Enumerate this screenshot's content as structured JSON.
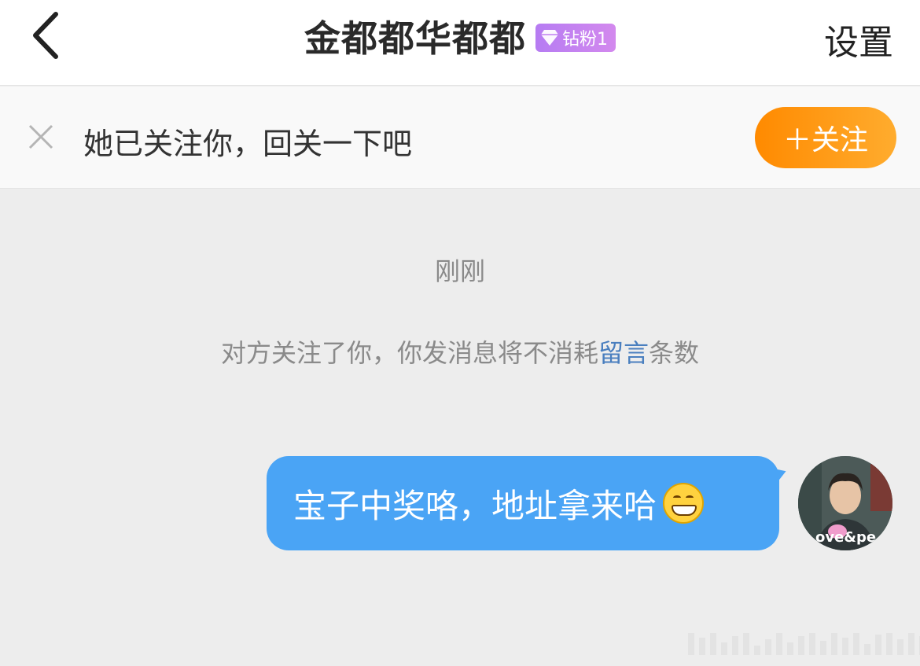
{
  "header": {
    "back_icon": "chevron-left-icon",
    "title": "金都都华都都",
    "badge": {
      "icon": "diamond-icon",
      "label": "钻粉1"
    },
    "settings_label": "设置"
  },
  "follow_bar": {
    "dismiss_icon": "close-icon",
    "text": "她已关注你，回关一下吧",
    "button_label": "＋关注",
    "button_color": "#ff9a0e"
  },
  "chat": {
    "timestamp": "刚刚",
    "system_msg": {
      "prefix": "对方关注了你，你发消息将不消耗",
      "link": "留言",
      "suffix": "条数"
    },
    "messages": [
      {
        "text": "宝子中奖咯，地址拿来哈",
        "emoji": "grin-emoji",
        "bubble_color": "#4aa4f5",
        "avatar_text": "ove&pe"
      }
    ]
  }
}
